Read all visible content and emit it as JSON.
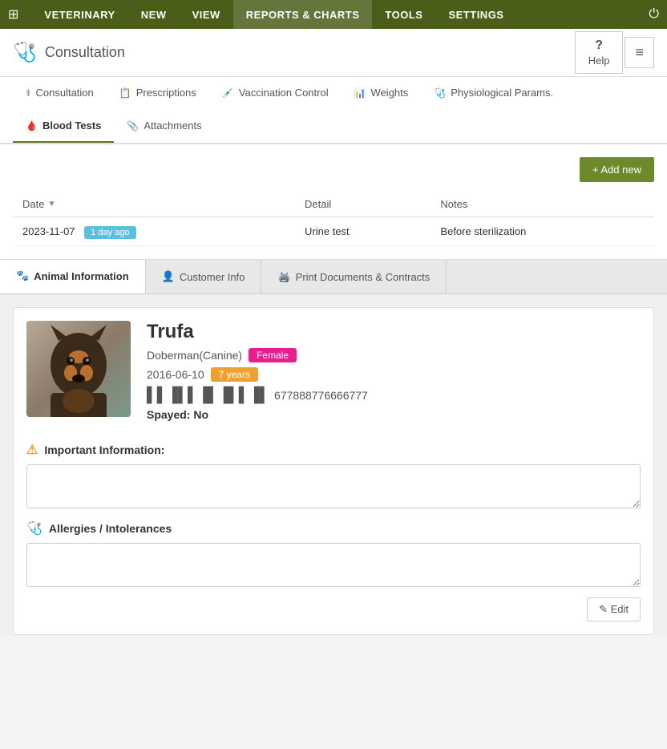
{
  "nav": {
    "items": [
      {
        "label": "VETERINARY",
        "active": false
      },
      {
        "label": "NEW",
        "active": false
      },
      {
        "label": "VIEW",
        "active": false
      },
      {
        "label": "REPORTS & CHARTS",
        "active": true
      },
      {
        "label": "TOOLS",
        "active": false
      },
      {
        "label": "SETTINGS",
        "active": false
      }
    ]
  },
  "header": {
    "title": "Consultation",
    "help_label": "Help"
  },
  "tabs": [
    {
      "label": "Consultation",
      "icon": "💊",
      "active": false
    },
    {
      "label": "Prescriptions",
      "icon": "📋",
      "active": false
    },
    {
      "label": "Vaccination Control",
      "icon": "💉",
      "active": false
    },
    {
      "label": "Weights",
      "icon": "📊",
      "active": false
    },
    {
      "label": "Physiological Params.",
      "icon": "🩺",
      "active": false
    },
    {
      "label": "Blood Tests",
      "icon": "🩸",
      "active": true
    },
    {
      "label": "Attachments",
      "icon": "📎",
      "active": false
    }
  ],
  "table": {
    "add_new_label": "+ Add new",
    "columns": [
      "Date",
      "Detail",
      "Notes"
    ],
    "rows": [
      {
        "date": "2023-11-07",
        "date_badge": "1 day ago",
        "detail": "Urine test",
        "notes": "Before sterilization"
      }
    ]
  },
  "bottom_tabs": [
    {
      "label": "Animal Information",
      "icon": "🐾",
      "active": true
    },
    {
      "label": "Customer Info",
      "icon": "👤",
      "active": false
    },
    {
      "label": "Print Documents & Contracts",
      "icon": "🖨️",
      "active": false
    }
  ],
  "animal": {
    "name": "Trufa",
    "breed": "Doberman(Canine)",
    "gender_badge": "Female",
    "dob": "2016-06-10",
    "age_badge": "7 years",
    "barcode": "677888776666777",
    "spayed_label": "Spayed:",
    "spayed_value": "No",
    "important_info_title": "Important Information:",
    "important_info_value": "",
    "allergies_title": "Allergies / Intolerances",
    "allergies_value": "",
    "edit_label": "✎ Edit"
  }
}
